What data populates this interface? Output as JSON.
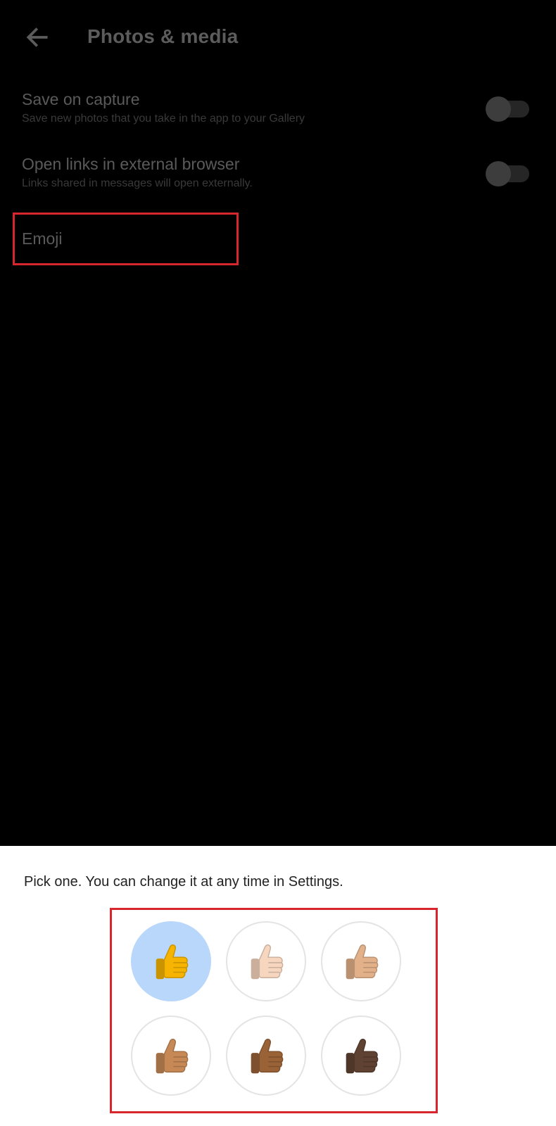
{
  "header": {
    "title": "Photos & media",
    "back_icon": "arrow-left-icon"
  },
  "settings": [
    {
      "title": "Save on capture",
      "subtitle": "Save new photos that you take in the app to your Gallery",
      "enabled": false
    },
    {
      "title": "Open links in external browser",
      "subtitle": "Links shared in messages will open externally.",
      "enabled": false
    }
  ],
  "emoji_row": {
    "title": "Emoji"
  },
  "sheet": {
    "prompt": "Pick one. You can change it at any time in Settings.",
    "options": [
      {
        "name": "thumbs-up-default",
        "color": "#f6b400",
        "selected": true
      },
      {
        "name": "thumbs-up-light",
        "color": "#f6d6bf",
        "selected": false
      },
      {
        "name": "thumbs-up-medium-light",
        "color": "#e2b18a",
        "selected": false
      },
      {
        "name": "thumbs-up-medium",
        "color": "#c68955",
        "selected": false
      },
      {
        "name": "thumbs-up-medium-dark",
        "color": "#9a6237",
        "selected": false
      },
      {
        "name": "thumbs-up-dark",
        "color": "#5f4232",
        "selected": false
      }
    ]
  },
  "colors": {
    "highlight": "#d7262d",
    "selected_bg": "#b9d7fb"
  }
}
